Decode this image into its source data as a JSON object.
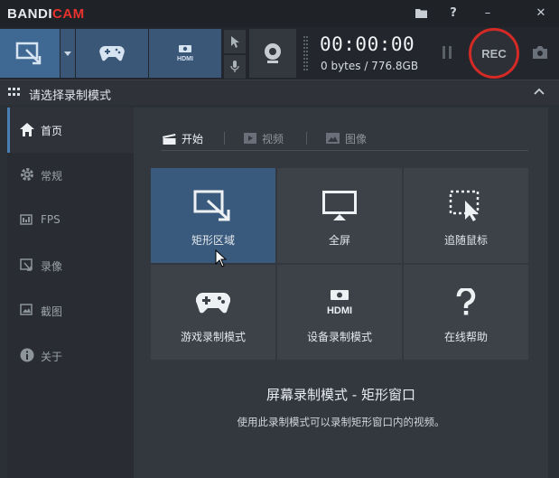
{
  "app": {
    "logo_part1": "BANDI",
    "logo_part2": "CAM",
    "logo_accent_color": "#e8322d"
  },
  "titlebar_buttons": [
    {
      "name": "folder-icon"
    },
    {
      "name": "help-icon",
      "glyph": "?"
    },
    {
      "name": "minimize-icon",
      "glyph": "–"
    },
    {
      "name": "close-icon",
      "glyph": "✕"
    }
  ],
  "toolbar": {
    "timer": "00:00:00",
    "file_size": "0 bytes / 776.8GB",
    "rec_label": "REC",
    "rec_color": "#d42a26"
  },
  "section": {
    "title": "请选择录制模式"
  },
  "sidebar": {
    "items": [
      {
        "label": "首页",
        "icon": "home-icon"
      },
      {
        "label": "常规",
        "icon": "gear-icon"
      },
      {
        "label": "FPS",
        "icon": "fps-icon"
      },
      {
        "label": "录像",
        "icon": "video-icon"
      },
      {
        "label": "截图",
        "icon": "image-icon"
      },
      {
        "label": "关于",
        "icon": "info-icon"
      }
    ]
  },
  "main": {
    "tabs": [
      {
        "label": "开始",
        "icon": "clapper-icon"
      },
      {
        "label": "视频",
        "icon": "play-icon"
      },
      {
        "label": "图像",
        "icon": "picture-icon"
      }
    ],
    "tiles": [
      {
        "label": "矩形区域",
        "icon": "rectangle-area-icon"
      },
      {
        "label": "全屏",
        "icon": "monitor-icon"
      },
      {
        "label": "追随鼠标",
        "icon": "follow-mouse-icon"
      },
      {
        "label": "游戏录制模式",
        "icon": "gamepad-icon"
      },
      {
        "label": "设备录制模式",
        "icon": "hdmi-icon"
      },
      {
        "label": "在线帮助",
        "icon": "question-icon"
      }
    ],
    "description_title": "屏幕录制模式 - 矩形窗口",
    "description_text": "使用此录制模式可以录制矩形窗口内的视频。"
  }
}
